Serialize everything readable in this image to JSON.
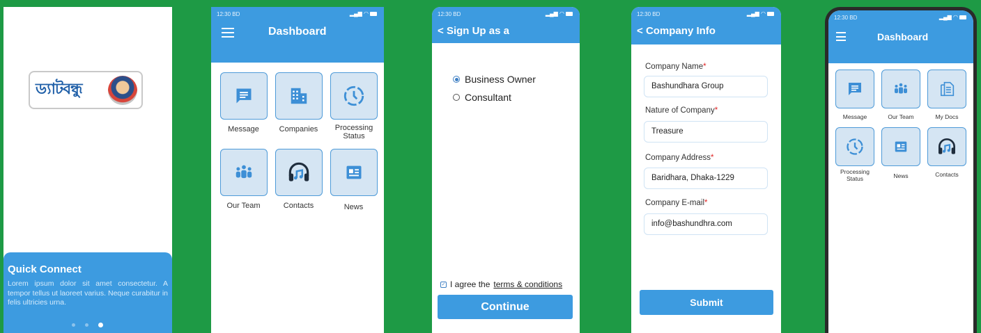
{
  "colors": {
    "background": "#1e9a45",
    "primary": "#3d9be0",
    "tile_bg": "#d5e5f3",
    "required": "#e02424"
  },
  "splash": {
    "logo_text": "ড্যাটবন্ধু",
    "quick_connect_title": "Quick Connect",
    "quick_connect_body": "Lorem ipsum dolor sit amet consectetur. A tempor tellus ut laoreet varius. Neque curabitur in felis ultricies urna.",
    "page_indicator": {
      "count": 3,
      "active": 3
    }
  },
  "dashboard": {
    "status_time": "12:30 BD",
    "title": "Dashboard",
    "tiles": [
      {
        "label": "Message",
        "icon": "message-icon"
      },
      {
        "label": "Companies",
        "icon": "building-icon"
      },
      {
        "label": "Processing Status",
        "icon": "clock-icon"
      },
      {
        "label": "Our Team",
        "icon": "team-icon"
      },
      {
        "label": "Contacts",
        "icon": "headphones-icon"
      },
      {
        "label": "News",
        "icon": "news-icon"
      }
    ]
  },
  "signup": {
    "status_time": "12:30 BD",
    "title": "Sign Up as a",
    "options": [
      {
        "label": "Business Owner",
        "selected": true
      },
      {
        "label": "Consultant",
        "selected": false
      }
    ],
    "agree_prefix": "I agree the",
    "terms_link": "terms & conditions",
    "agree_checked": true,
    "continue_label": "Continue"
  },
  "company_info": {
    "status_time": "12:30 BD",
    "title": "Company Info",
    "fields": [
      {
        "label": "Company Name",
        "value": "Bashundhara Group"
      },
      {
        "label": "Nature of Company",
        "value": "Treasure"
      },
      {
        "label": "Company Address",
        "value": "Baridhara, Dhaka-1229"
      },
      {
        "label": "Company E-mail",
        "value": "info@bashundhra.com"
      }
    ],
    "required_mark": "*",
    "submit_label": "Submit"
  },
  "dashboard2": {
    "status_time": "12:30 BD",
    "title": "Dashboard",
    "tiles": [
      {
        "label": "Message",
        "icon": "message-icon"
      },
      {
        "label": "Our Team",
        "icon": "team-icon"
      },
      {
        "label": "My Docs",
        "icon": "docs-icon"
      },
      {
        "label": "Processing Status",
        "icon": "clock-icon"
      },
      {
        "label": "News",
        "icon": "news-icon"
      },
      {
        "label": "Contacts",
        "icon": "headphones-icon"
      }
    ]
  }
}
